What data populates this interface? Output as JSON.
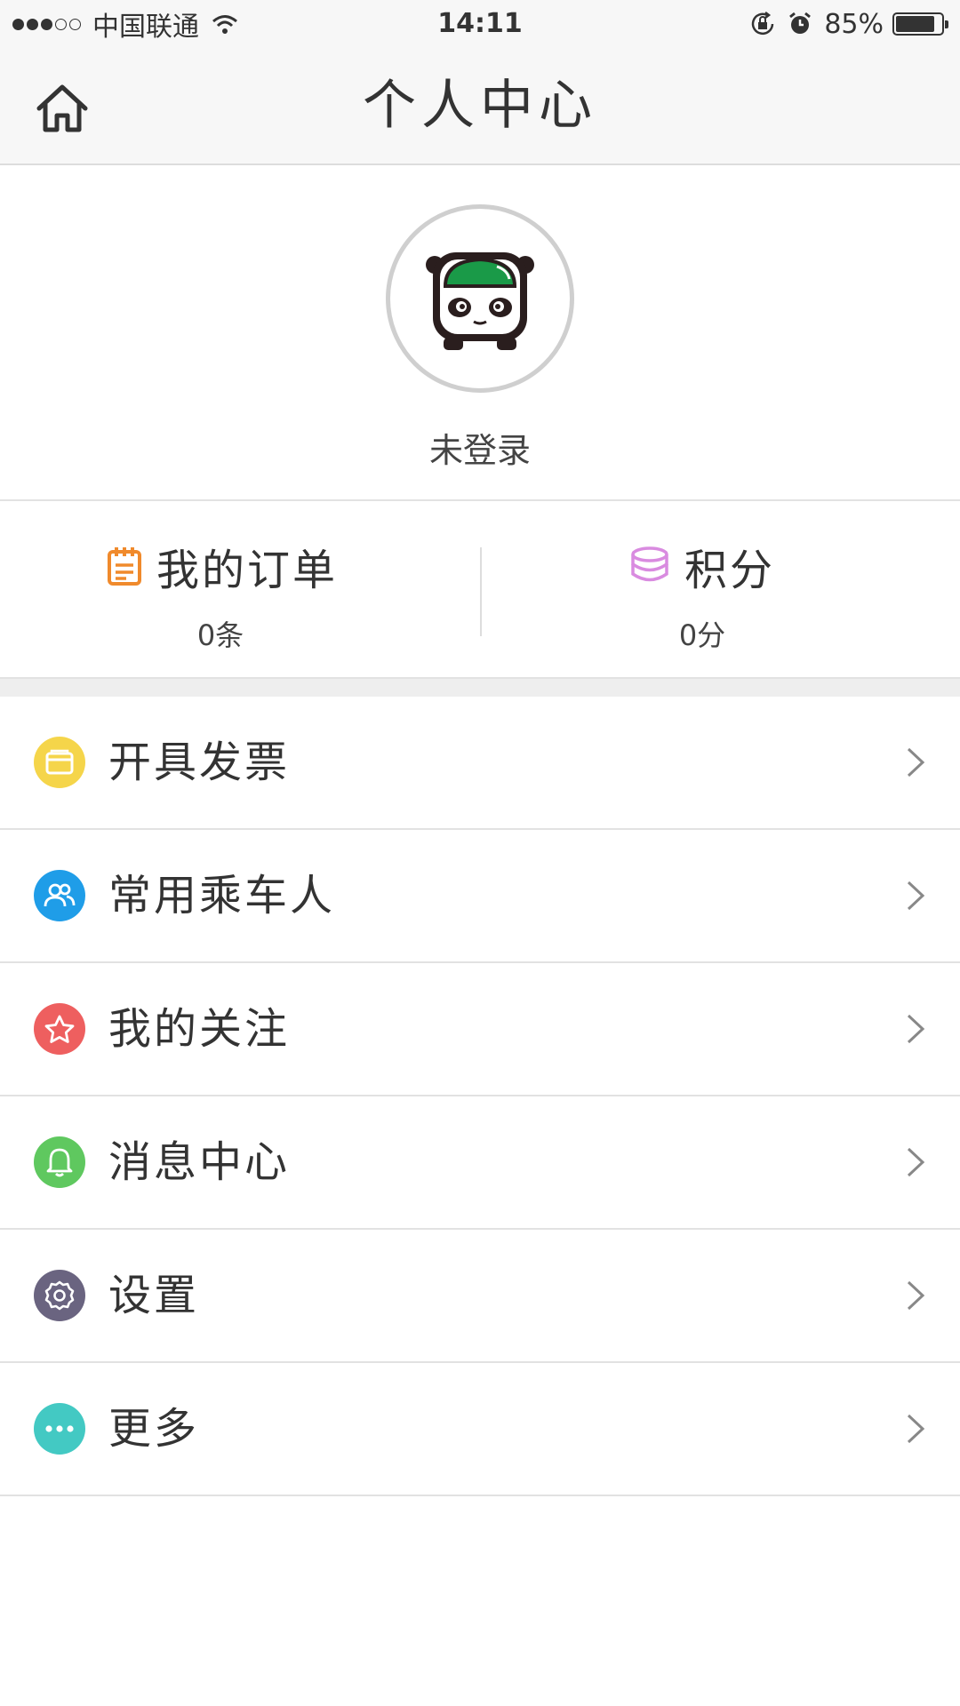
{
  "status_bar": {
    "carrier": "中国联通",
    "time": "14:11",
    "battery": "85%",
    "battery_level": 0.85
  },
  "nav": {
    "title": "个人中心"
  },
  "profile": {
    "login_status": "未登录"
  },
  "stats": {
    "orders": {
      "label": "我的订单",
      "value": "0条",
      "icon": "calendar-icon",
      "color": "#f08a2c"
    },
    "points": {
      "label": "积分",
      "value": "0分",
      "icon": "coins-icon",
      "color": "#d98be0"
    }
  },
  "menu": [
    {
      "label": "开具发票",
      "icon": "invoice-card-icon",
      "color": "#f5d54a"
    },
    {
      "label": "常用乘车人",
      "icon": "users-icon",
      "color": "#1f9de8"
    },
    {
      "label": "我的关注",
      "icon": "star-icon",
      "color": "#ee5f5f"
    },
    {
      "label": "消息中心",
      "icon": "bell-icon",
      "color": "#5fc85f"
    },
    {
      "label": "设置",
      "icon": "gear-icon",
      "color": "#6a6480"
    },
    {
      "label": "更多",
      "icon": "more-dots-icon",
      "color": "#43c9c3"
    }
  ]
}
